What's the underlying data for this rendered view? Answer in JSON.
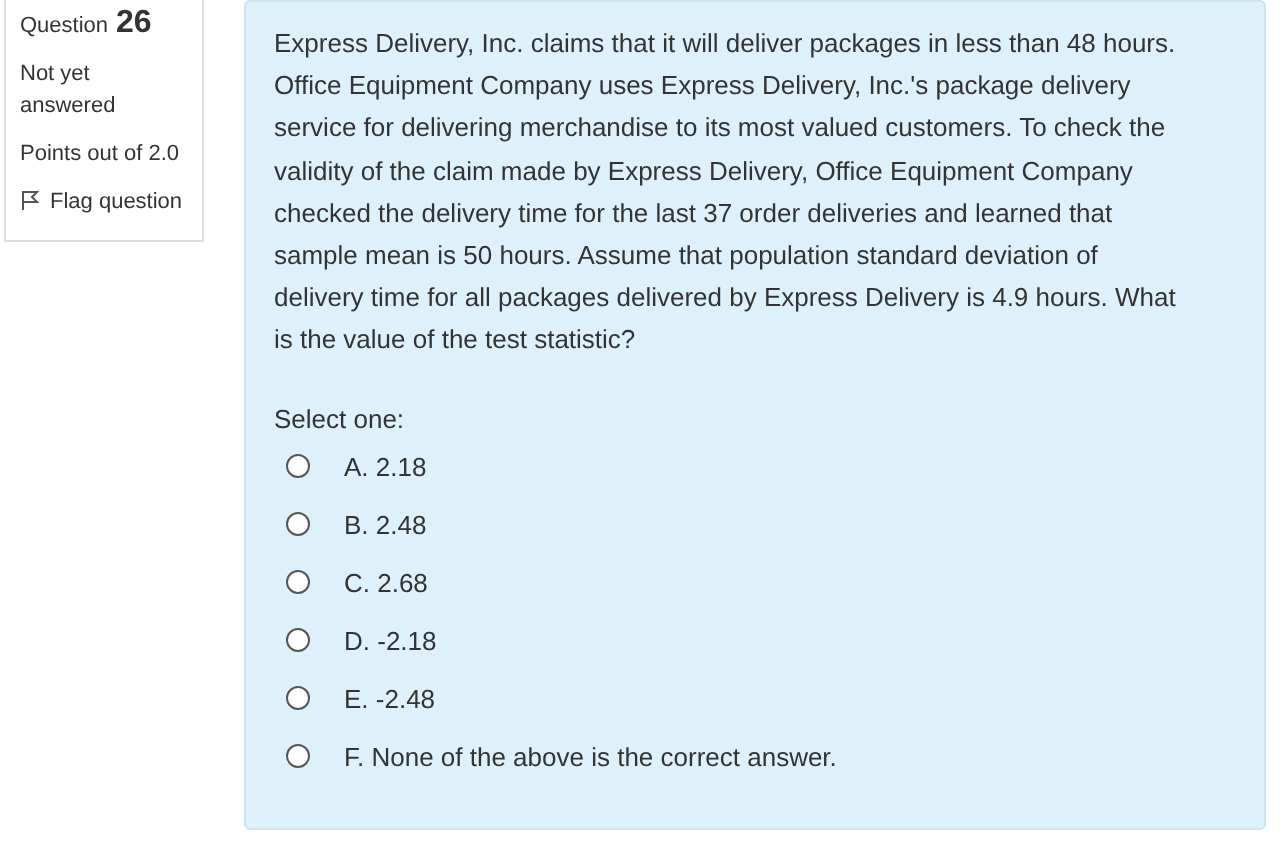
{
  "info": {
    "question_label": "Question",
    "question_number": "26",
    "status": "Not yet answered",
    "points": "Points out of 2.0",
    "flag": "Flag question"
  },
  "question": {
    "text": "Express Delivery, Inc. claims that it will deliver packages in less than 48 hours. Office Equipment Company uses Express Delivery, Inc.'s package delivery service for delivering merchandise to its most valued customers. To check the validity of the claim made by Express Delivery, Office Equipment Company checked the delivery time for the last 37 order deliveries and learned that sample mean is 50 hours. Assume that population standard deviation of delivery time for all packages delivered by Express Delivery is 4.9 hours. What is the value of the test statistic?",
    "prompt": "Select one:",
    "options": [
      {
        "label": "A. 2.18",
        "selected": false
      },
      {
        "label": "B. 2.48",
        "selected": false
      },
      {
        "label": "C. 2.68",
        "selected": false
      },
      {
        "label": "D. -2.18",
        "selected": false
      },
      {
        "label": "E. -2.48",
        "selected": false
      },
      {
        "label": "F. None of the above is the correct answer.",
        "selected": false
      }
    ]
  }
}
